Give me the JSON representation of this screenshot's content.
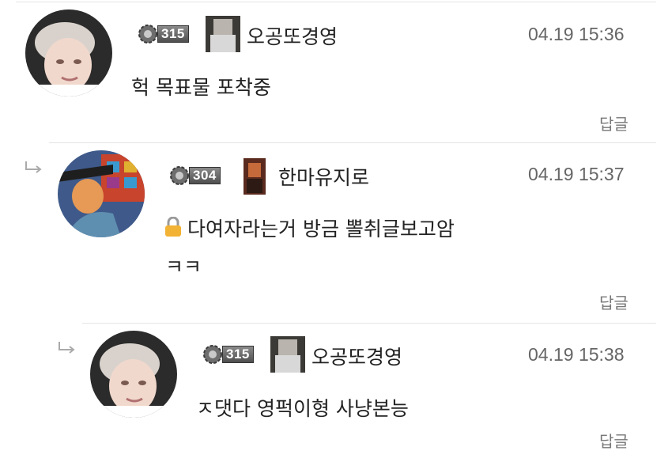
{
  "comments": [
    {
      "level": "315",
      "nickname": "오공또경영",
      "timestamp": "04.19 15:36",
      "text": "헉 목표물 포착중",
      "reply_label": "답글"
    },
    {
      "level": "304",
      "nickname": "한마유지로",
      "timestamp": "04.19 15:37",
      "text_line1": "다여자라는거 방금 뽈취글보고암",
      "text_line2": "ㅋㅋ",
      "reply_label": "답글",
      "lock_icon": "lock-icon"
    },
    {
      "level": "315",
      "nickname": "오공또경영",
      "timestamp": "04.19 15:38",
      "text": "ㅈ댓다 영퍽이형 사냥본능",
      "reply_label": "답글"
    }
  ],
  "colors": {
    "timestamp": "#666666",
    "reply": "#777777",
    "divider": "#e4e4e4"
  }
}
